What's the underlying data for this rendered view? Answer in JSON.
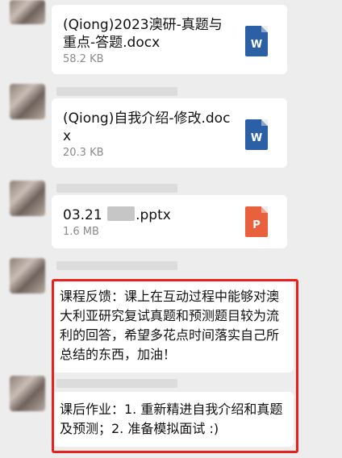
{
  "messages": [
    {
      "type": "file",
      "file_name": "(Qiong)2023澳研-真题与重点-答题.docx",
      "file_size": "58.2 KB",
      "icon": "word-doc-icon",
      "icon_letter": "W"
    },
    {
      "type": "file",
      "file_name": "(Qiong)自我介绍-修改.docx",
      "file_size": "20.3 KB",
      "icon": "word-doc-icon",
      "icon_letter": "W"
    },
    {
      "type": "file",
      "file_name_prefix": "03.21 ",
      "file_name_suffix": ".pptx",
      "file_size": "1.6 MB",
      "icon": "ppt-doc-icon",
      "icon_letter": "P"
    },
    {
      "type": "text",
      "text": "课程反馈：课上在互动过程中能够对澳大利亚研究复试真题和预测题目较为流利的回答，希望多花点时间落实自己所总结的东西，加油！"
    },
    {
      "type": "text",
      "text": "课后作业：1. 重新精进自我介绍和真题及预测；2. 准备模拟面试 :)"
    }
  ],
  "colors": {
    "background": "#ededed",
    "highlight": "#e8211c",
    "word": "#2b5fa6",
    "ppt": "#e8603c"
  }
}
